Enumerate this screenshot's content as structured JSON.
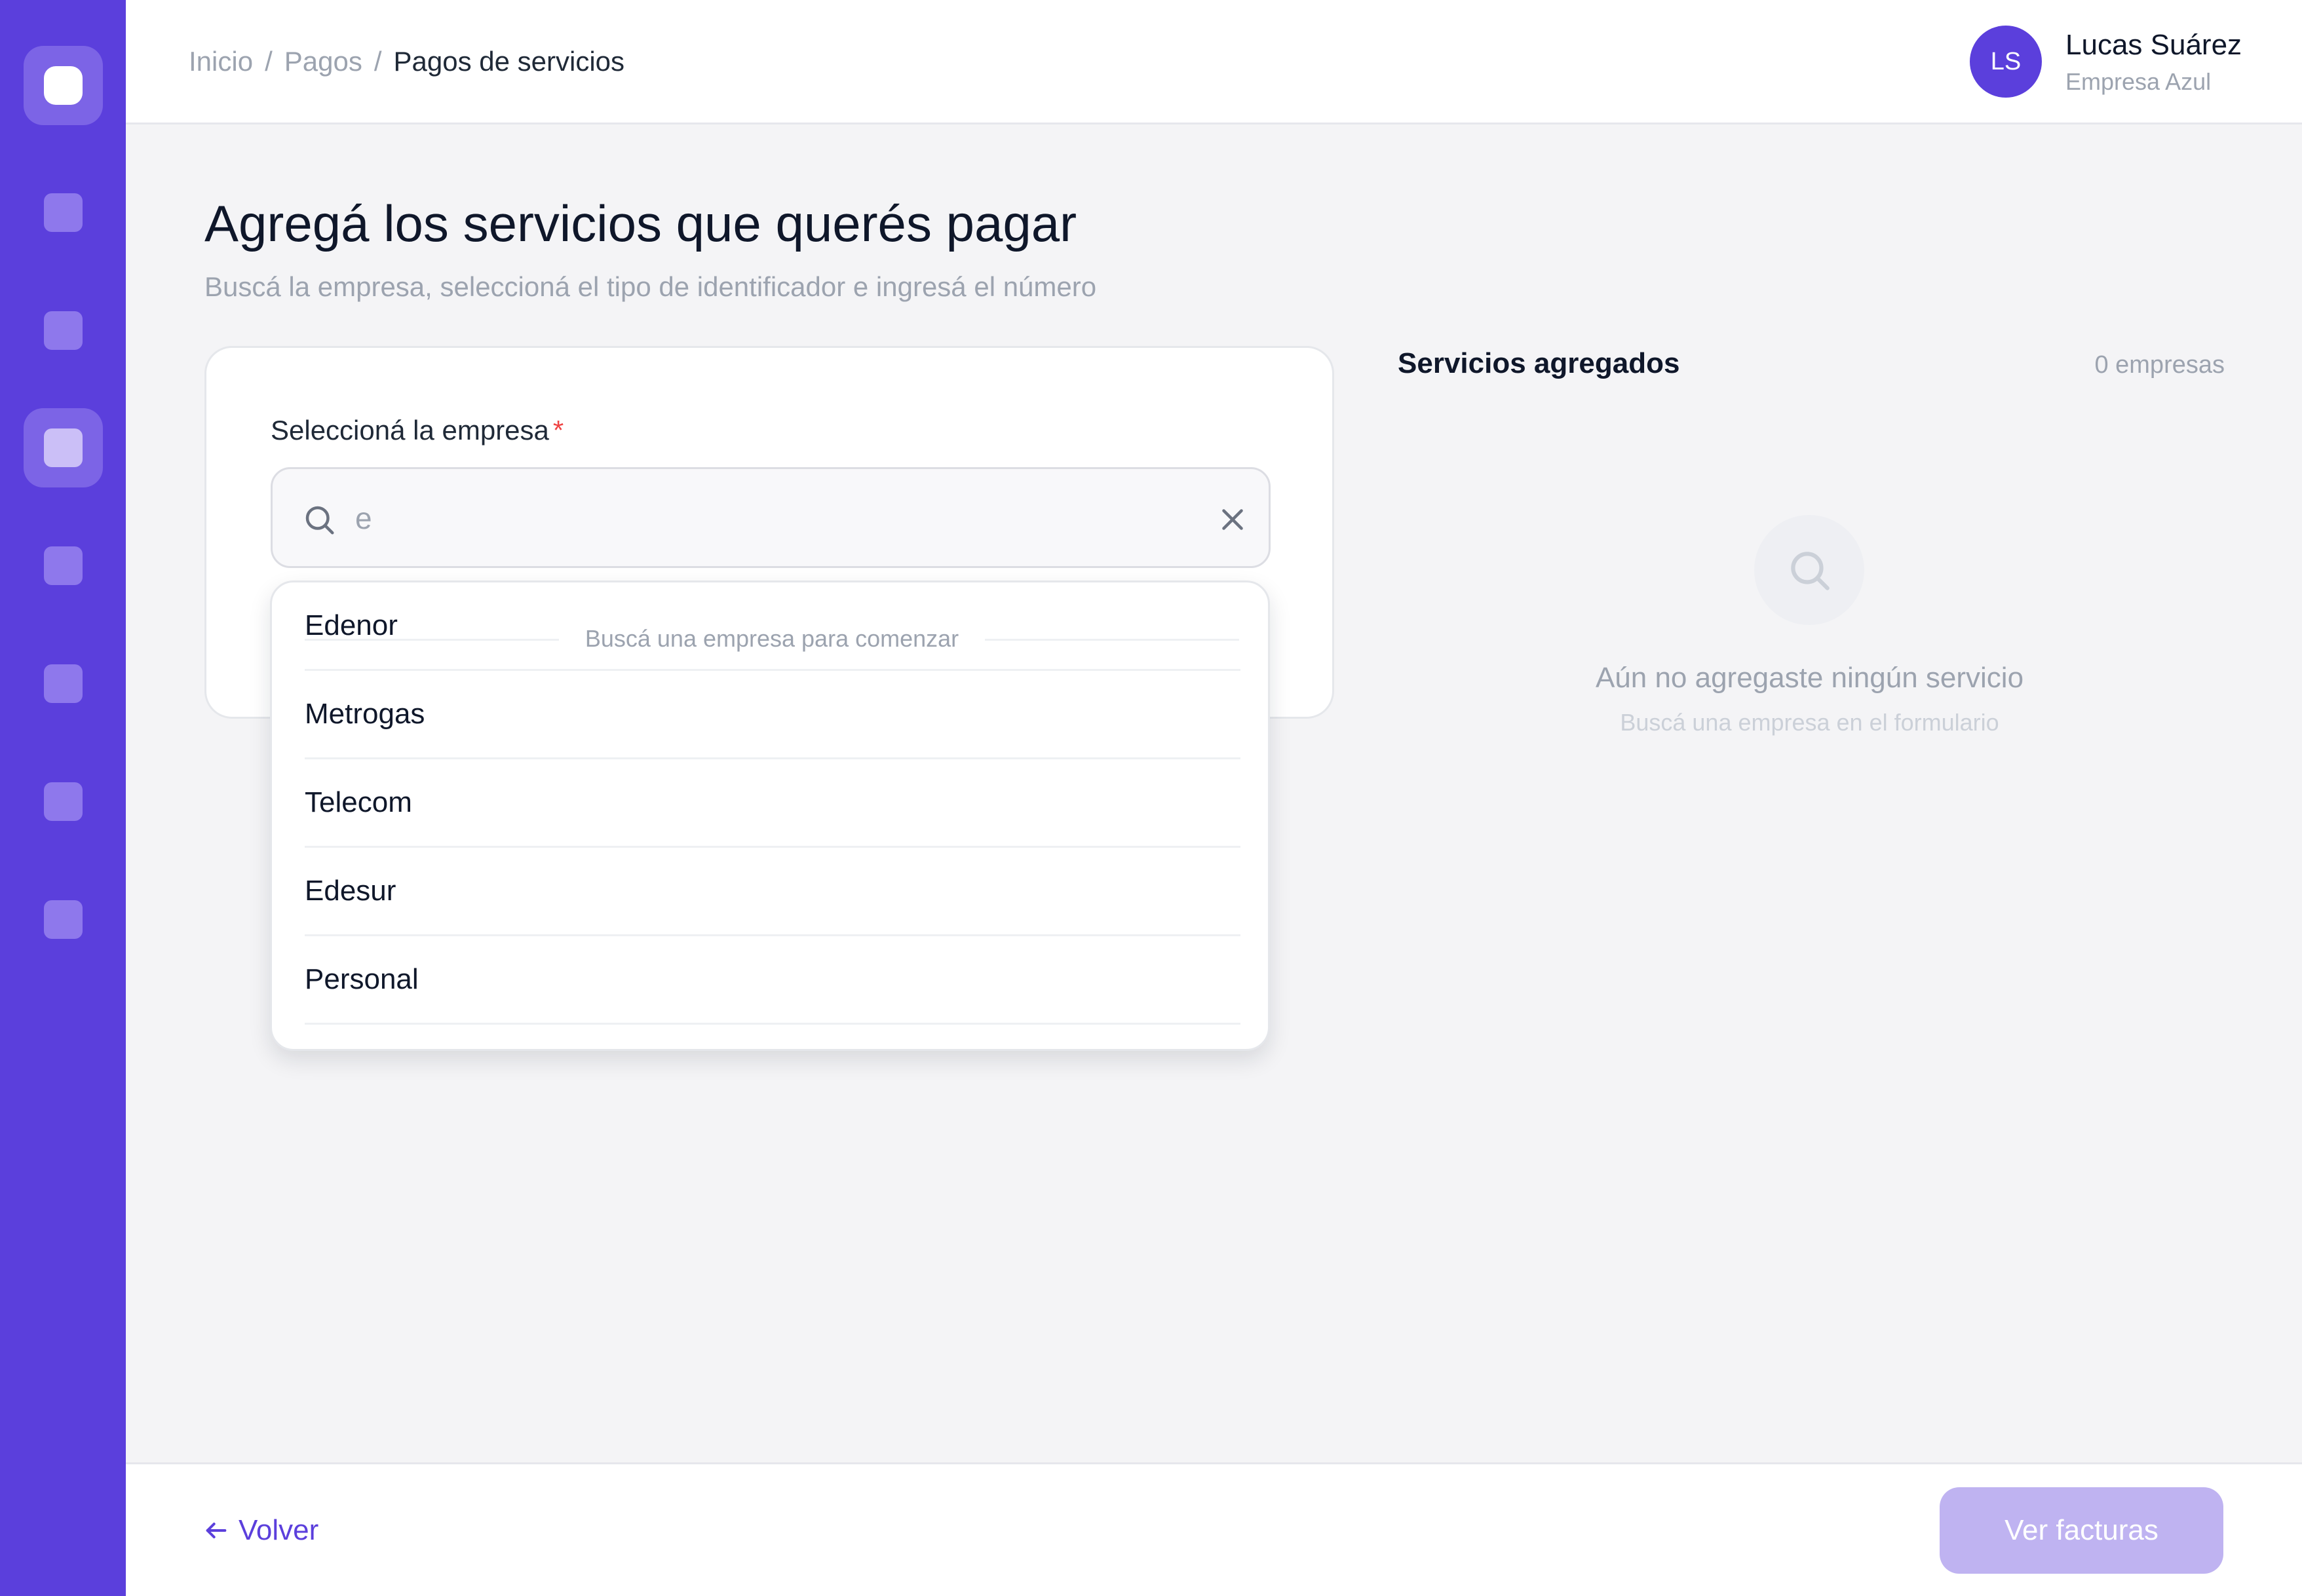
{
  "sidebar": {
    "logo_icon": "app-logo-icon",
    "items": [
      {
        "icon": "nav-square-icon",
        "active": false
      },
      {
        "icon": "nav-square-icon",
        "active": false
      },
      {
        "icon": "nav-square-icon",
        "active": true
      },
      {
        "icon": "nav-square-icon",
        "active": false
      },
      {
        "icon": "nav-square-icon",
        "active": false
      },
      {
        "icon": "nav-square-icon",
        "active": false
      },
      {
        "icon": "nav-square-icon",
        "active": false
      }
    ],
    "colors": {
      "background": "#5b3fdc",
      "item": "#8e78ec",
      "active_item": "#cbbff7"
    }
  },
  "header": {
    "breadcrumb": [
      "Inicio",
      "Pagos",
      "Pagos de servicios"
    ],
    "breadcrumb_separator": "/",
    "user": {
      "initials": "LS",
      "name": "Lucas Suárez",
      "company": "Empresa Azul"
    }
  },
  "main": {
    "title": "Agregá los servicios que querés pagar",
    "subtitle": "Buscá la empresa, seleccioná el tipo de identificador e ingresá el número",
    "form": {
      "company_label": "Seleccioná la empresa",
      "required_mark": "*",
      "search_value": "e",
      "search_icon": "search-icon",
      "clear_icon": "close-icon"
    },
    "dropdown": {
      "hint": "Buscá una empresa para comenzar",
      "options": [
        "Edenor",
        "Metrogas",
        "Telecom",
        "Edesur",
        "Personal"
      ]
    },
    "panel": {
      "title": "Servicios agregados",
      "count": "0 empresas",
      "empty_title": "Aún no agregaste ningún servicio",
      "empty_subtitle": "Buscá una empresa en el formulario"
    }
  },
  "footer": {
    "back_label": "Volver",
    "primary_label": "Ver facturas",
    "primary_disabled": true
  },
  "colors": {
    "accent": "#5b3fdc",
    "primary_disabled": "#bfb3f1",
    "required": "#ef4444",
    "muted_text": "#9ca3af"
  }
}
